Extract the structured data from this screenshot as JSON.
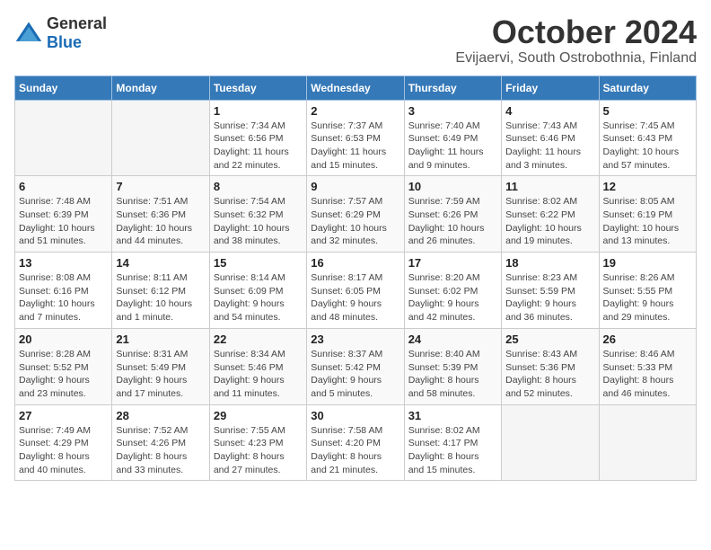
{
  "header": {
    "logo_general": "General",
    "logo_blue": "Blue",
    "title": "October 2024",
    "subtitle": "Evijaervi, South Ostrobothnia, Finland"
  },
  "weekdays": [
    "Sunday",
    "Monday",
    "Tuesday",
    "Wednesday",
    "Thursday",
    "Friday",
    "Saturday"
  ],
  "weeks": [
    [
      {
        "day": "",
        "info": ""
      },
      {
        "day": "",
        "info": ""
      },
      {
        "day": "1",
        "info": "Sunrise: 7:34 AM\nSunset: 6:56 PM\nDaylight: 11 hours\nand 22 minutes."
      },
      {
        "day": "2",
        "info": "Sunrise: 7:37 AM\nSunset: 6:53 PM\nDaylight: 11 hours\nand 15 minutes."
      },
      {
        "day": "3",
        "info": "Sunrise: 7:40 AM\nSunset: 6:49 PM\nDaylight: 11 hours\nand 9 minutes."
      },
      {
        "day": "4",
        "info": "Sunrise: 7:43 AM\nSunset: 6:46 PM\nDaylight: 11 hours\nand 3 minutes."
      },
      {
        "day": "5",
        "info": "Sunrise: 7:45 AM\nSunset: 6:43 PM\nDaylight: 10 hours\nand 57 minutes."
      }
    ],
    [
      {
        "day": "6",
        "info": "Sunrise: 7:48 AM\nSunset: 6:39 PM\nDaylight: 10 hours\nand 51 minutes."
      },
      {
        "day": "7",
        "info": "Sunrise: 7:51 AM\nSunset: 6:36 PM\nDaylight: 10 hours\nand 44 minutes."
      },
      {
        "day": "8",
        "info": "Sunrise: 7:54 AM\nSunset: 6:32 PM\nDaylight: 10 hours\nand 38 minutes."
      },
      {
        "day": "9",
        "info": "Sunrise: 7:57 AM\nSunset: 6:29 PM\nDaylight: 10 hours\nand 32 minutes."
      },
      {
        "day": "10",
        "info": "Sunrise: 7:59 AM\nSunset: 6:26 PM\nDaylight: 10 hours\nand 26 minutes."
      },
      {
        "day": "11",
        "info": "Sunrise: 8:02 AM\nSunset: 6:22 PM\nDaylight: 10 hours\nand 19 minutes."
      },
      {
        "day": "12",
        "info": "Sunrise: 8:05 AM\nSunset: 6:19 PM\nDaylight: 10 hours\nand 13 minutes."
      }
    ],
    [
      {
        "day": "13",
        "info": "Sunrise: 8:08 AM\nSunset: 6:16 PM\nDaylight: 10 hours\nand 7 minutes."
      },
      {
        "day": "14",
        "info": "Sunrise: 8:11 AM\nSunset: 6:12 PM\nDaylight: 10 hours\nand 1 minute."
      },
      {
        "day": "15",
        "info": "Sunrise: 8:14 AM\nSunset: 6:09 PM\nDaylight: 9 hours\nand 54 minutes."
      },
      {
        "day": "16",
        "info": "Sunrise: 8:17 AM\nSunset: 6:05 PM\nDaylight: 9 hours\nand 48 minutes."
      },
      {
        "day": "17",
        "info": "Sunrise: 8:20 AM\nSunset: 6:02 PM\nDaylight: 9 hours\nand 42 minutes."
      },
      {
        "day": "18",
        "info": "Sunrise: 8:23 AM\nSunset: 5:59 PM\nDaylight: 9 hours\nand 36 minutes."
      },
      {
        "day": "19",
        "info": "Sunrise: 8:26 AM\nSunset: 5:55 PM\nDaylight: 9 hours\nand 29 minutes."
      }
    ],
    [
      {
        "day": "20",
        "info": "Sunrise: 8:28 AM\nSunset: 5:52 PM\nDaylight: 9 hours\nand 23 minutes."
      },
      {
        "day": "21",
        "info": "Sunrise: 8:31 AM\nSunset: 5:49 PM\nDaylight: 9 hours\nand 17 minutes."
      },
      {
        "day": "22",
        "info": "Sunrise: 8:34 AM\nSunset: 5:46 PM\nDaylight: 9 hours\nand 11 minutes."
      },
      {
        "day": "23",
        "info": "Sunrise: 8:37 AM\nSunset: 5:42 PM\nDaylight: 9 hours\nand 5 minutes."
      },
      {
        "day": "24",
        "info": "Sunrise: 8:40 AM\nSunset: 5:39 PM\nDaylight: 8 hours\nand 58 minutes."
      },
      {
        "day": "25",
        "info": "Sunrise: 8:43 AM\nSunset: 5:36 PM\nDaylight: 8 hours\nand 52 minutes."
      },
      {
        "day": "26",
        "info": "Sunrise: 8:46 AM\nSunset: 5:33 PM\nDaylight: 8 hours\nand 46 minutes."
      }
    ],
    [
      {
        "day": "27",
        "info": "Sunrise: 7:49 AM\nSunset: 4:29 PM\nDaylight: 8 hours\nand 40 minutes."
      },
      {
        "day": "28",
        "info": "Sunrise: 7:52 AM\nSunset: 4:26 PM\nDaylight: 8 hours\nand 33 minutes."
      },
      {
        "day": "29",
        "info": "Sunrise: 7:55 AM\nSunset: 4:23 PM\nDaylight: 8 hours\nand 27 minutes."
      },
      {
        "day": "30",
        "info": "Sunrise: 7:58 AM\nSunset: 4:20 PM\nDaylight: 8 hours\nand 21 minutes."
      },
      {
        "day": "31",
        "info": "Sunrise: 8:02 AM\nSunset: 4:17 PM\nDaylight: 8 hours\nand 15 minutes."
      },
      {
        "day": "",
        "info": ""
      },
      {
        "day": "",
        "info": ""
      }
    ]
  ]
}
